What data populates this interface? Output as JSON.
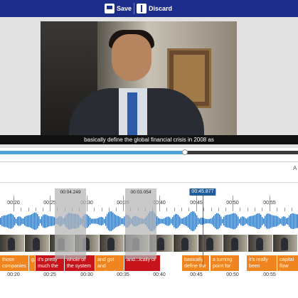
{
  "toolbar": {
    "save_label": "Save",
    "discard_label": "Discard"
  },
  "video": {
    "subtitle": "basically define the global financial crisis in 2008 as",
    "progress": 0.62
  },
  "edge_text": "A",
  "timeline": {
    "playhead_time": "00:45.877",
    "top_ticks": [
      "00:20",
      "00:25",
      "00:30",
      "00:35",
      "00:40",
      "00:45",
      "00:50",
      "00:55"
    ],
    "bottom_ticks": [
      "00:20",
      "00:25",
      "00:30",
      "00:35",
      "00:40",
      "00:45",
      "00:50",
      "00:55"
    ],
    "markers": [
      {
        "time": "00:04.249"
      },
      {
        "time": "00:03.054"
      }
    ],
    "words": [
      {
        "text": "those companies",
        "color": "orange"
      },
      {
        "text": "g...",
        "color": "orange"
      },
      {
        "text": "it's pretty much the",
        "color": "red"
      },
      {
        "text": "whole of the system",
        "color": "red"
      },
      {
        "text": "and got and multinatio...",
        "color": "orange"
      },
      {
        "text": "and...ically of",
        "color": "red"
      },
      {
        "text": "basically define the",
        "color": "orange"
      },
      {
        "text": "a turning point for",
        "color": "orange"
      },
      {
        "text": "it's really been",
        "color": "orange"
      },
      {
        "text": "capital flow between",
        "color": "orange"
      }
    ]
  },
  "colors": {
    "toolbar": "#1c2d8c",
    "progress": "#4aa3d8",
    "waveform": "#2e6fb7",
    "word_orange": "#f0841e",
    "word_red": "#c7141a",
    "playhead": "#1f5d9c"
  }
}
